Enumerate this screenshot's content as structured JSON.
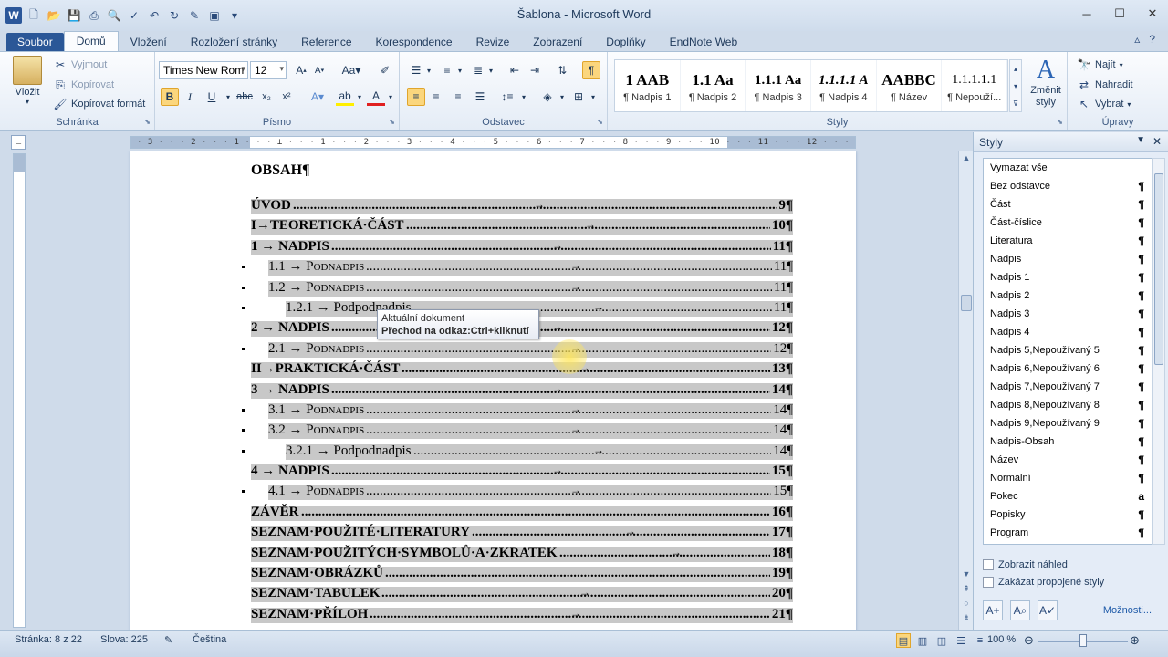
{
  "window": {
    "title": "Šablona - Microsoft Word"
  },
  "tabs": [
    "Soubor",
    "Domů",
    "Vložení",
    "Rozložení stránky",
    "Reference",
    "Korespondence",
    "Revize",
    "Zobrazení",
    "Doplňky",
    "EndNote Web"
  ],
  "active_tab": "Domů",
  "clipboard": {
    "paste": "Vložit",
    "cut": "Vyjmout",
    "copy": "Kopírovat",
    "format_painter": "Kopírovat formát",
    "label": "Schránka"
  },
  "font": {
    "family": "Times New Rom",
    "size": "12",
    "label": "Písmo"
  },
  "paragraph": {
    "label": "Odstavec"
  },
  "styles_group": {
    "label": "Styly",
    "change_styles": "Změnit styly",
    "gallery": [
      {
        "sample": "1 AAB",
        "name": "¶ Nadpis 1",
        "italic": false
      },
      {
        "sample": "1.1 Aa",
        "name": "¶ Nadpis 2",
        "italic": false
      },
      {
        "sample": "1.1.1 Aa",
        "name": "¶ Nadpis 3",
        "italic": false
      },
      {
        "sample": "1.1.1.1 A",
        "name": "¶ Nadpis 4",
        "italic": true
      },
      {
        "sample": "AABBC",
        "name": "¶ Název",
        "italic": false
      },
      {
        "sample": "1.1.1.1.1",
        "name": "¶ Nepouží...",
        "italic": false
      }
    ]
  },
  "editing": {
    "find": "Najít",
    "replace": "Nahradit",
    "select": "Vybrat",
    "label": "Úpravy"
  },
  "ruler": {
    "scale": "· 3 · · · 2 · · · 1 · · · ⊥ · · · 1 · · · 2 · · · 3 · · · 4 · · · 5 · · · 6 · · · 7 · · · 8 · · · 9 · · · 10 · · · 11 · · · 12 · · · 13 · · · 14 · ·15 · · · 16 · · · 17 ·"
  },
  "document": {
    "heading": "OBSAH¶",
    "toc": [
      {
        "text": "ÚVOD",
        "page": "9¶",
        "level": 1,
        "indent": 0,
        "arrow": 310
      },
      {
        "text": "I→TEORETICKÁ·ČÁST",
        "page": "10¶",
        "level": 1,
        "indent": 0,
        "arrow": 366
      },
      {
        "text": "1 → NADPIS",
        "page": "11¶",
        "level": 1,
        "indent": 0,
        "arrow": 330
      },
      {
        "text": "1.1 → Podnadpis",
        "page": "11¶",
        "level": 2,
        "indent": 19,
        "arrow": 350
      },
      {
        "text": "1.2 → Podnadpis",
        "page": "11¶",
        "level": 2,
        "indent": 19,
        "arrow": 350
      },
      {
        "text": "1.2.1 → Podpodnadpis",
        "page": "11¶",
        "level": 3,
        "indent": 38,
        "arrow": 375
      },
      {
        "text": "2 → NADPIS",
        "page": "12¶",
        "level": 1,
        "indent": 0,
        "arrow": 330
      },
      {
        "text": "2.1 → Podnadpis",
        "page": "12¶",
        "level": 2,
        "indent": 19,
        "arrow": 350
      },
      {
        "text": "II→PRAKTICKÁ·ČÁST",
        "page": "13¶",
        "level": 1,
        "indent": 0,
        "arrow": 360
      },
      {
        "text": "3 → NADPIS",
        "page": "14¶",
        "level": 1,
        "indent": 0,
        "arrow": 330
      },
      {
        "text": "3.1 → Podnadpis",
        "page": "14¶",
        "level": 2,
        "indent": 19,
        "arrow": 350
      },
      {
        "text": "3.2 → Podnadpis",
        "page": "14¶",
        "level": 2,
        "indent": 19,
        "arrow": 350
      },
      {
        "text": "3.2.1 → Podpodnadpis",
        "page": "14¶",
        "level": 3,
        "indent": 38,
        "arrow": 375
      },
      {
        "text": "4 → NADPIS",
        "page": "15¶",
        "level": 1,
        "indent": 0,
        "arrow": 330
      },
      {
        "text": "4.1 → Podnadpis",
        "page": "15¶",
        "level": 2,
        "indent": 19,
        "arrow": 350
      },
      {
        "text": "ZÁVĚR",
        "page": "16¶",
        "level": 1,
        "indent": 0,
        "arrow": 0
      },
      {
        "text": "SEZNAM·POUŽITÉ·LITERATURY",
        "page": "17¶",
        "level": 1,
        "indent": 0,
        "arrow": 410
      },
      {
        "text": "SEZNAM·POUŽITÝCH·SYMBOLŮ·A·ZKRATEK",
        "page": "18¶",
        "level": 1,
        "indent": 0,
        "arrow": 460
      },
      {
        "text": "SEZNAM·OBRÁZKŮ",
        "page": "19¶",
        "level": 1,
        "indent": 0,
        "arrow": 0
      },
      {
        "text": "SEZNAM·TABULEK",
        "page": "20¶",
        "level": 1,
        "indent": 0,
        "arrow": 360
      },
      {
        "text": "SEZNAM·PŘÍLOH",
        "page": "21¶",
        "level": 1,
        "indent": 0,
        "arrow": 350
      }
    ]
  },
  "tooltip": {
    "line1": "Aktuální dokument",
    "line2": "Přechod na odkaz:Ctrl+kliknutí"
  },
  "styles_pane": {
    "title": "Styly",
    "items": [
      {
        "name": "Vymazat vše",
        "mark": ""
      },
      {
        "name": "Bez odstavce",
        "mark": "¶"
      },
      {
        "name": "Část",
        "mark": "¶"
      },
      {
        "name": "Část-číslice",
        "mark": "¶"
      },
      {
        "name": "Literatura",
        "mark": "¶"
      },
      {
        "name": "Nadpis",
        "mark": "¶"
      },
      {
        "name": "Nadpis 1",
        "mark": "¶"
      },
      {
        "name": "Nadpis 2",
        "mark": "¶"
      },
      {
        "name": "Nadpis 3",
        "mark": "¶"
      },
      {
        "name": "Nadpis 4",
        "mark": "¶"
      },
      {
        "name": "Nadpis 5,Nepoužívaný 5",
        "mark": "¶"
      },
      {
        "name": "Nadpis 6,Nepoužívaný 6",
        "mark": "¶"
      },
      {
        "name": "Nadpis 7,Nepoužívaný 7",
        "mark": "¶"
      },
      {
        "name": "Nadpis 8,Nepoužívaný 8",
        "mark": "¶"
      },
      {
        "name": "Nadpis 9,Nepoužívaný 9",
        "mark": "¶"
      },
      {
        "name": "Nadpis-Obsah",
        "mark": "¶"
      },
      {
        "name": "Název",
        "mark": "¶"
      },
      {
        "name": "Normální",
        "mark": "¶"
      },
      {
        "name": "Pokec",
        "mark": "a"
      },
      {
        "name": "Popisky",
        "mark": "¶"
      },
      {
        "name": "Program",
        "mark": "¶"
      }
    ],
    "show_preview": "Zobrazit náhled",
    "disable_linked": "Zakázat propojené styly",
    "options": "Možnosti..."
  },
  "statusbar": {
    "page": "Stránka: 8 z 22",
    "words": "Slova: 225",
    "language": "Čeština",
    "zoom": "100 %"
  }
}
